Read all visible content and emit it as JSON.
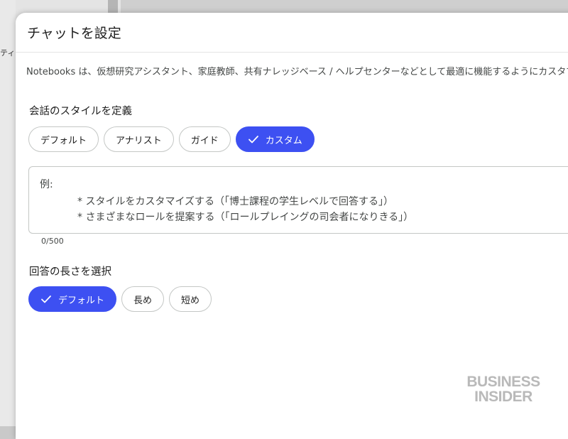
{
  "background": {
    "text": "ティア"
  },
  "dialog": {
    "title": "チャットを設定",
    "description": "Notebooks は、仮想研究アシスタント、家庭教師、共有ナレッジベース / ヘルプセンターなどとして最適に機能するようにカスタマイ"
  },
  "style_section": {
    "label": "会話のスタイルを定義",
    "chips": [
      {
        "label": "デフォルト",
        "selected": false
      },
      {
        "label": "アナリスト",
        "selected": false
      },
      {
        "label": "ガイド",
        "selected": false
      },
      {
        "label": "カスタム",
        "selected": true
      }
    ]
  },
  "custom_prompt": {
    "placeholder_head": "例:",
    "placeholder_line1": "* スタイルをカスタマイズする（「博士課程の学生レベルで回答する」）",
    "placeholder_line2": "* さまざまなロールを提案する（「ロールプレイングの司会者になりきる」）",
    "counter": "0/500"
  },
  "length_section": {
    "label": "回答の長さを選択",
    "chips": [
      {
        "label": "デフォルト",
        "selected": true
      },
      {
        "label": "長め",
        "selected": false
      },
      {
        "label": "短め",
        "selected": false
      }
    ]
  },
  "watermark": {
    "line1": "BUSINESS",
    "line2": "INSIDER"
  },
  "colors": {
    "accent": "#3d50f2",
    "border": "#c4c7c5"
  }
}
